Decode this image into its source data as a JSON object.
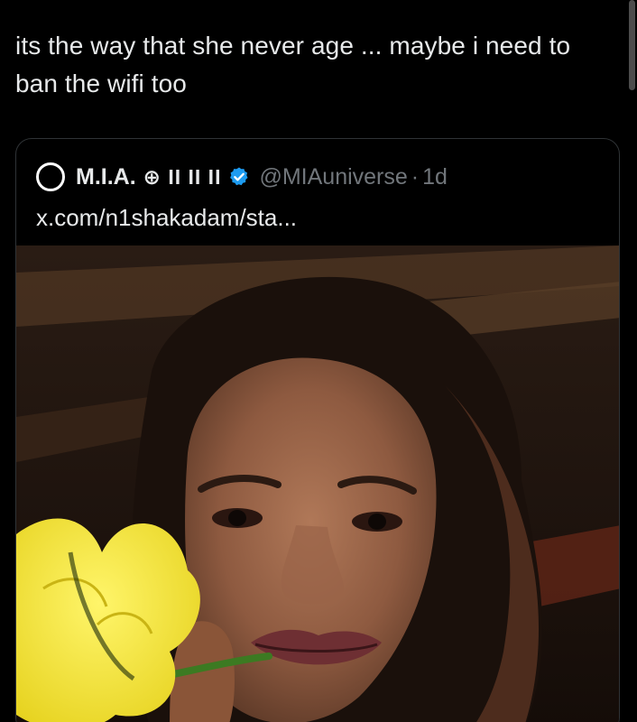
{
  "tweet": {
    "text": "its the way that she never age ... maybe i need to ban the wifi too"
  },
  "quoted_tweet": {
    "display_name": "M.I.A.",
    "name_extra": "⊕ II II II",
    "handle": "@MIAuniverse",
    "separator": "·",
    "time": "1d",
    "text": "x.com/n1shakadam/sta...",
    "verified_icon": "verified-badge-icon",
    "accent_color": "#1d9bf0"
  },
  "colors": {
    "background": "#000000",
    "text_primary": "#e7e9ea",
    "text_secondary": "#71767b",
    "border": "#2f3336"
  }
}
